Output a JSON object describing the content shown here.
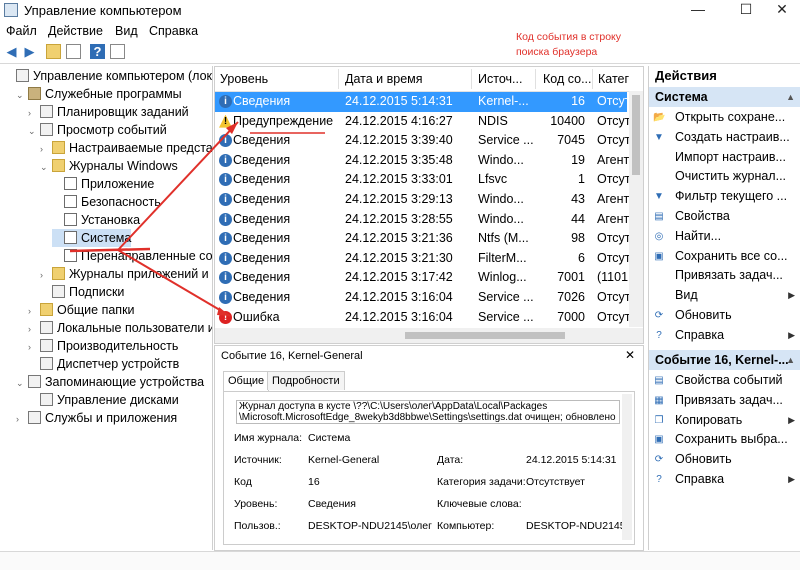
{
  "window": {
    "title": "Управление компьютером"
  },
  "menu": [
    "Файл",
    "Действие",
    "Вид",
    "Справка"
  ],
  "annotation": "Код события в строку поиска браузера",
  "tree": [
    {
      "label": "Управление компьютером (локал",
      "level": 0,
      "arrow": "",
      "icon": "computer-icon"
    },
    {
      "label": "Служебные программы",
      "level": 1,
      "arrow": "⌄",
      "icon": "tools-icon"
    },
    {
      "label": "Планировщик заданий",
      "level": 2,
      "arrow": "›",
      "icon": "scheduler-icon"
    },
    {
      "label": "Просмотр событий",
      "level": 2,
      "arrow": "⌄",
      "icon": "event-viewer-icon"
    },
    {
      "label": "Настраиваемые представ",
      "level": 3,
      "arrow": "›",
      "icon": "folder-icon"
    },
    {
      "label": "Журналы Windows",
      "level": 3,
      "arrow": "⌄",
      "icon": "folder-icon"
    },
    {
      "label": "Приложение",
      "level": 4,
      "arrow": "",
      "icon": "log-icon"
    },
    {
      "label": "Безопасность",
      "level": 4,
      "arrow": "",
      "icon": "log-icon"
    },
    {
      "label": "Установка",
      "level": 4,
      "arrow": "",
      "icon": "log-icon"
    },
    {
      "label": "Система",
      "level": 4,
      "arrow": "",
      "icon": "log-icon"
    },
    {
      "label": "Перенаправленные со",
      "level": 4,
      "arrow": "",
      "icon": "log-icon"
    },
    {
      "label": "Журналы приложений и",
      "level": 3,
      "arrow": "›",
      "icon": "folder-icon"
    },
    {
      "label": "Подписки",
      "level": 3,
      "arrow": "",
      "icon": "subscriptions-icon"
    },
    {
      "label": "Общие папки",
      "level": 2,
      "arrow": "›",
      "icon": "shared-folder-icon"
    },
    {
      "label": "Локальные пользователи и",
      "level": 2,
      "arrow": "›",
      "icon": "users-icon"
    },
    {
      "label": "Производительность",
      "level": 2,
      "arrow": "›",
      "icon": "performance-icon"
    },
    {
      "label": "Диспетчер устройств",
      "level": 2,
      "arrow": "",
      "icon": "device-manager-icon"
    },
    {
      "label": "Запоминающие устройства",
      "level": 1,
      "arrow": "⌄",
      "icon": "storage-icon"
    },
    {
      "label": "Управление дисками",
      "level": 2,
      "arrow": "",
      "icon": "disk-icon"
    },
    {
      "label": "Службы и приложения",
      "level": 1,
      "arrow": "›",
      "icon": "services-icon"
    }
  ],
  "columns": [
    "Уровень",
    "Дата и время",
    "Источ...",
    "Код со...",
    "Катег"
  ],
  "events": [
    {
      "level": "Сведения",
      "type": "info",
      "date": "24.12.2015 5:14:31",
      "source": "Kernel-...",
      "code": "16",
      "cat": "Отсут"
    },
    {
      "level": "Предупреждение",
      "type": "warn",
      "date": "24.12.2015 4:16:27",
      "source": "NDIS",
      "code": "10400",
      "cat": "Отсут"
    },
    {
      "level": "Сведения",
      "type": "info",
      "date": "24.12.2015 3:39:40",
      "source": "Service ...",
      "code": "7045",
      "cat": "Отсут"
    },
    {
      "level": "Сведения",
      "type": "info",
      "date": "24.12.2015 3:35:48",
      "source": "Windo...",
      "code": "19",
      "cat": "Агент"
    },
    {
      "level": "Сведения",
      "type": "info",
      "date": "24.12.2015 3:33:01",
      "source": "Lfsvc",
      "code": "1",
      "cat": "Отсут"
    },
    {
      "level": "Сведения",
      "type": "info",
      "date": "24.12.2015 3:29:13",
      "source": "Windo...",
      "code": "43",
      "cat": "Агент"
    },
    {
      "level": "Сведения",
      "type": "info",
      "date": "24.12.2015 3:28:55",
      "source": "Windo...",
      "code": "44",
      "cat": "Агент"
    },
    {
      "level": "Сведения",
      "type": "info",
      "date": "24.12.2015 3:21:36",
      "source": "Ntfs (M...",
      "code": "98",
      "cat": "Отсут"
    },
    {
      "level": "Сведения",
      "type": "info",
      "date": "24.12.2015 3:21:30",
      "source": "FilterM...",
      "code": "6",
      "cat": "Отсут"
    },
    {
      "level": "Сведения",
      "type": "info",
      "date": "24.12.2015 3:17:42",
      "source": "Winlog...",
      "code": "7001",
      "cat": "(1101"
    },
    {
      "level": "Сведения",
      "type": "info",
      "date": "24.12.2015 3:16:04",
      "source": "Service ...",
      "code": "7026",
      "cat": "Отсут"
    },
    {
      "level": "Ошибка",
      "type": "err",
      "date": "24.12.2015 3:16:04",
      "source": "Service ...",
      "code": "7000",
      "cat": "Отсут"
    }
  ],
  "detail": {
    "header": "Событие 16, Kernel-General",
    "tab_general": "Общие",
    "tab_details": "Подробности",
    "desc_line1": "Журнал доступа в кусте \\??\\C:\\Users\\олег\\AppData\\Local\\Packages",
    "desc_line2": "\\Microsoft.MicrosoftEdge_8wekyb3d8bbwe\\Settings\\settings.dat очищен; обновлено",
    "log_label": "Имя журнала:",
    "log_value": "Система",
    "source_label": "Источник:",
    "source_value": "Kernel-General",
    "date_label": "Дата:",
    "date_value": "24.12.2015 5:14:31",
    "code_label": "Код",
    "code_value": "16",
    "cat_label": "Категория задачи:",
    "cat_value": "Отсутствует",
    "level_label": "Уровень:",
    "level_value": "Сведения",
    "keywords_label": "Ключевые слова:",
    "user_label": "Пользов.:",
    "user_value": "DESKTOP-NDU2145\\олег",
    "comp_label": "Компьютер:",
    "comp_value": "DESKTOP-NDU2145"
  },
  "actions": {
    "title": "Действия",
    "section1": "Система",
    "items1": [
      {
        "label": "Открыть сохране...",
        "icon": "open-icon",
        "sub": ""
      },
      {
        "label": "Создать настраив...",
        "icon": "filter-icon",
        "sub": ""
      },
      {
        "label": "Импорт настраив...",
        "icon": "",
        "sub": ""
      },
      {
        "label": "Очистить журнал...",
        "icon": "",
        "sub": ""
      },
      {
        "label": "Фильтр текущего ...",
        "icon": "filter-icon",
        "sub": ""
      },
      {
        "label": "Свойства",
        "icon": "properties-icon",
        "sub": ""
      },
      {
        "label": "Найти...",
        "icon": "binoculars-icon",
        "sub": ""
      },
      {
        "label": "Сохранить все со...",
        "icon": "save-icon",
        "sub": ""
      },
      {
        "label": "Привязать задач...",
        "icon": "",
        "sub": ""
      },
      {
        "label": "Вид",
        "icon": "",
        "sub": "▶"
      },
      {
        "label": "Обновить",
        "icon": "refresh-icon",
        "sub": ""
      },
      {
        "label": "Справка",
        "icon": "help-icon",
        "sub": "▶"
      }
    ],
    "section2": "Событие 16, Kernel-...",
    "items2": [
      {
        "label": "Свойства событий",
        "icon": "properties-icon",
        "sub": ""
      },
      {
        "label": "Привязать задач...",
        "icon": "task-icon",
        "sub": ""
      },
      {
        "label": "Копировать",
        "icon": "copy-icon",
        "sub": "▶"
      },
      {
        "label": "Сохранить выбра...",
        "icon": "save-icon",
        "sub": ""
      },
      {
        "label": "Обновить",
        "icon": "refresh-icon",
        "sub": ""
      },
      {
        "label": "Справка",
        "icon": "help-icon",
        "sub": "▶"
      }
    ]
  },
  "colors": {
    "selection": "#3399ff",
    "annotation": "#e0302a",
    "section_bg": "#d6e5f5"
  }
}
